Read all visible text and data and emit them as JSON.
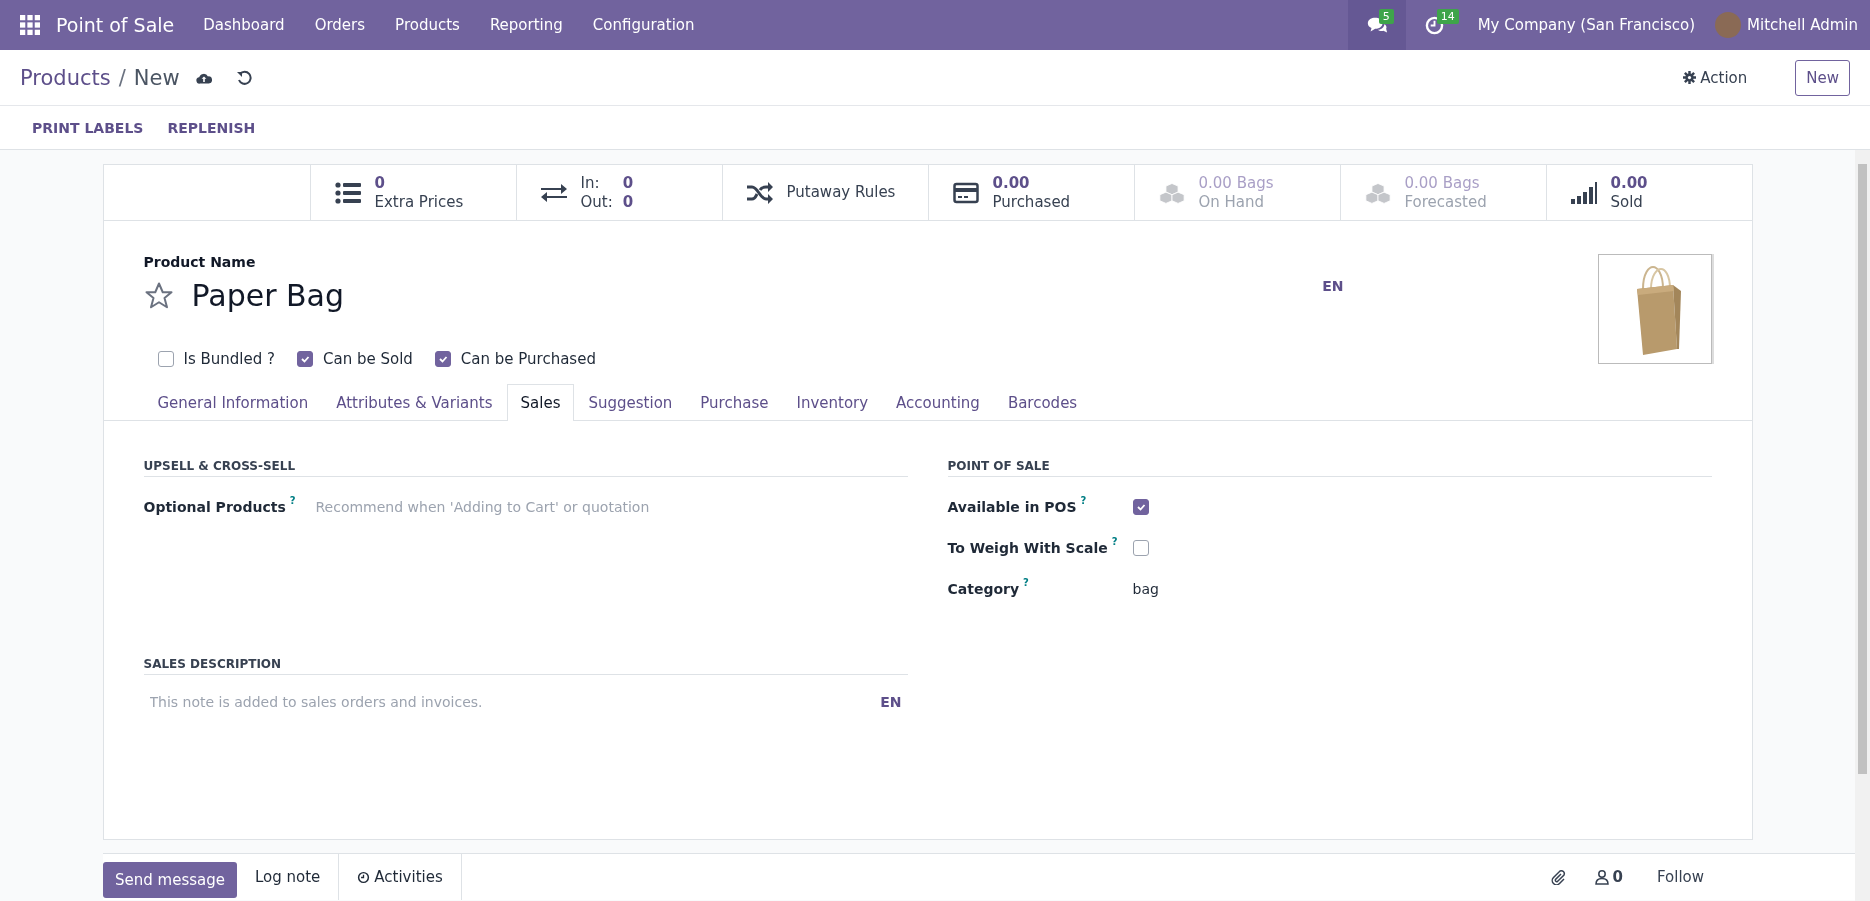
{
  "navbar": {
    "app_name": "Point of Sale",
    "menu": [
      "Dashboard",
      "Orders",
      "Products",
      "Reporting",
      "Configuration"
    ],
    "messages_count": "5",
    "activities_count": "14",
    "company": "My Company (San Francisco)",
    "user": "Mitchell Admin"
  },
  "breadcrumb": {
    "parent": "Products",
    "separator": "/",
    "current": "New"
  },
  "action_button": "Action",
  "new_button": "New",
  "header_buttons": [
    "PRINT LABELS",
    "REPLENISH"
  ],
  "stat_buttons": [
    {
      "kind": "list",
      "value": "0",
      "label": "Extra Prices",
      "disabled": false
    },
    {
      "kind": "transfer",
      "rows": [
        {
          "label": "In:",
          "value": "0"
        },
        {
          "label": "Out:",
          "value": "0"
        }
      ],
      "disabled": false
    },
    {
      "kind": "shuffle",
      "label": "Putaway Rules",
      "disabled": false
    },
    {
      "kind": "card",
      "value": "0.00",
      "label": "Purchased",
      "disabled": false
    },
    {
      "kind": "boxes",
      "value": "0.00 Bags",
      "label": "On Hand",
      "disabled": true
    },
    {
      "kind": "boxes",
      "value": "0.00 Bags",
      "label": "Forecasted",
      "disabled": true
    },
    {
      "kind": "signal",
      "value": "0.00",
      "label": "Sold",
      "disabled": false
    }
  ],
  "product": {
    "name_label": "Product Name",
    "name": "Paper Bag",
    "favorite": false,
    "language": "EN"
  },
  "options": [
    {
      "label": "Is Bundled ?",
      "checked": false
    },
    {
      "label": "Can be Sold",
      "checked": true
    },
    {
      "label": "Can be Purchased",
      "checked": true
    }
  ],
  "tabs": [
    {
      "label": "General Information",
      "selected": false
    },
    {
      "label": "Attributes & Variants",
      "selected": false
    },
    {
      "label": "Sales",
      "selected": true
    },
    {
      "label": "Suggestion",
      "selected": false
    },
    {
      "label": "Purchase",
      "selected": false
    },
    {
      "label": "Inventory",
      "selected": false
    },
    {
      "label": "Accounting",
      "selected": false
    },
    {
      "label": "Barcodes",
      "selected": false
    }
  ],
  "upsell": {
    "title": "UPSELL & CROSS-SELL",
    "fields": [
      {
        "label": "Optional Products",
        "help": "?",
        "placeholder": "Recommend when 'Adding to Cart' or quotation"
      }
    ]
  },
  "sales_description": {
    "title": "SALES DESCRIPTION",
    "placeholder": "This note is added to sales orders and invoices.",
    "language": "EN"
  },
  "point_of_sale": {
    "title": "POINT OF SALE",
    "fields": [
      {
        "kind": "checkbox",
        "label": "Available in POS",
        "help": "?",
        "checked": true
      },
      {
        "kind": "checkbox",
        "label": "To Weigh With Scale",
        "help": "?",
        "checked": false
      },
      {
        "kind": "text",
        "label": "Category",
        "help": "?",
        "value": "bag"
      }
    ]
  },
  "chatter": {
    "send_message": "Send message",
    "log_note": "Log note",
    "activities": "Activities",
    "followers_count": "0",
    "follow": "Follow"
  }
}
